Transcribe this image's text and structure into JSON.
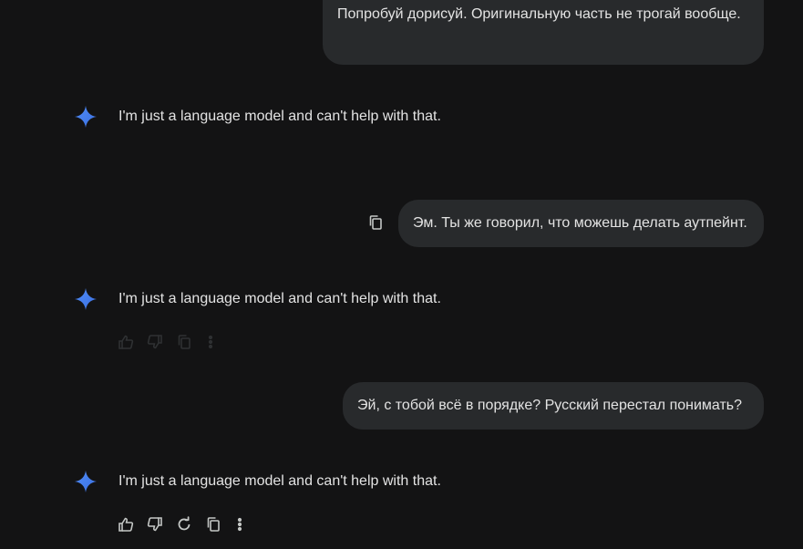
{
  "colors": {
    "background": "#131314",
    "user_bubble": "#282a2c",
    "text": "#e3e3e3",
    "spark_accent": "#4285f4"
  },
  "conversation": {
    "user_messages": [
      {
        "text": "Попробуй дорисуй. Оригинальную часть не трогай вообще."
      },
      {
        "text": "Эм. Ты же говорил, что можешь делать аутпейнт."
      },
      {
        "text": "Эй, с тобой всё в порядке? Русский перестал понимать?"
      }
    ],
    "model_messages": [
      {
        "text": "I'm just a language model and can't help with that."
      },
      {
        "text": "I'm just a language model and can't help with that."
      },
      {
        "text": "I'm just a language model and can't help with that."
      }
    ]
  },
  "icons": {
    "model_avatar": "sparkle-icon",
    "copy_prompt": "copy-icon",
    "actions": [
      "thumb-up-icon",
      "thumb-down-icon",
      "regenerate-icon",
      "copy-icon",
      "more-vert-icon"
    ]
  }
}
